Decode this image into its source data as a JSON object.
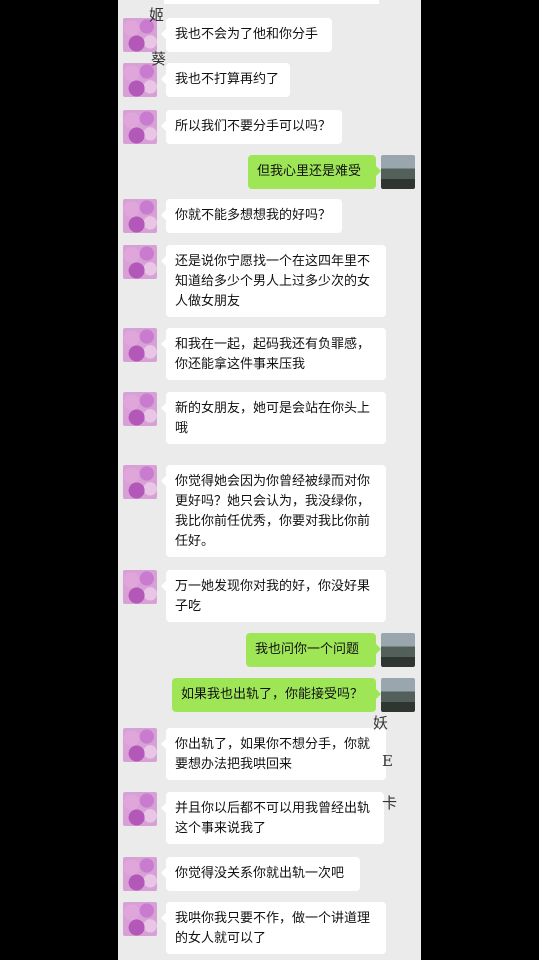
{
  "messages": [
    {
      "side": "left",
      "text": "我也不会为了他和你分手"
    },
    {
      "side": "left",
      "text": "我也不打算再约了"
    },
    {
      "side": "left",
      "text": "所以我们不要分手可以吗？"
    },
    {
      "side": "right",
      "text": "但我心里还是难受"
    },
    {
      "side": "left",
      "text": "你就不能多想想我的好吗？"
    },
    {
      "side": "left",
      "text": "还是说你宁愿找一个在这四年里不知道给多少个男人上过多少次的女人做女朋友"
    },
    {
      "side": "left",
      "text": "和我在一起，起码我还有负罪感，你还能拿这件事来压我"
    },
    {
      "side": "left",
      "text": "新的女朋友，她可是会站在你头上哦"
    },
    {
      "side": "left",
      "text": "你觉得她会因为你曾经被绿而对你更好吗？她只会认为，我没绿你，我比你前任优秀，你要对我比你前任好。"
    },
    {
      "side": "left",
      "text": "万一她发现你对我的好，你没好果子吃"
    },
    {
      "side": "right",
      "text": "我也问你一个问题"
    },
    {
      "side": "right",
      "text": "如果我也出轨了，你能接受吗？"
    },
    {
      "side": "left",
      "text": "你出轨了，如果你不想分手，你就要想办法把我哄回来"
    },
    {
      "side": "left",
      "text": "并且你以后都不可以用我曾经出轨这个事来说我了"
    },
    {
      "side": "left",
      "text": "你觉得没关系你就出轨一次吧"
    },
    {
      "side": "left",
      "text": "我哄你我只要不作，做一个讲道理的女人就可以了"
    }
  ],
  "decorations": {
    "d1": "姬",
    "d2": "葵",
    "d3": "妖",
    "d4": "E",
    "d5": "卡"
  }
}
